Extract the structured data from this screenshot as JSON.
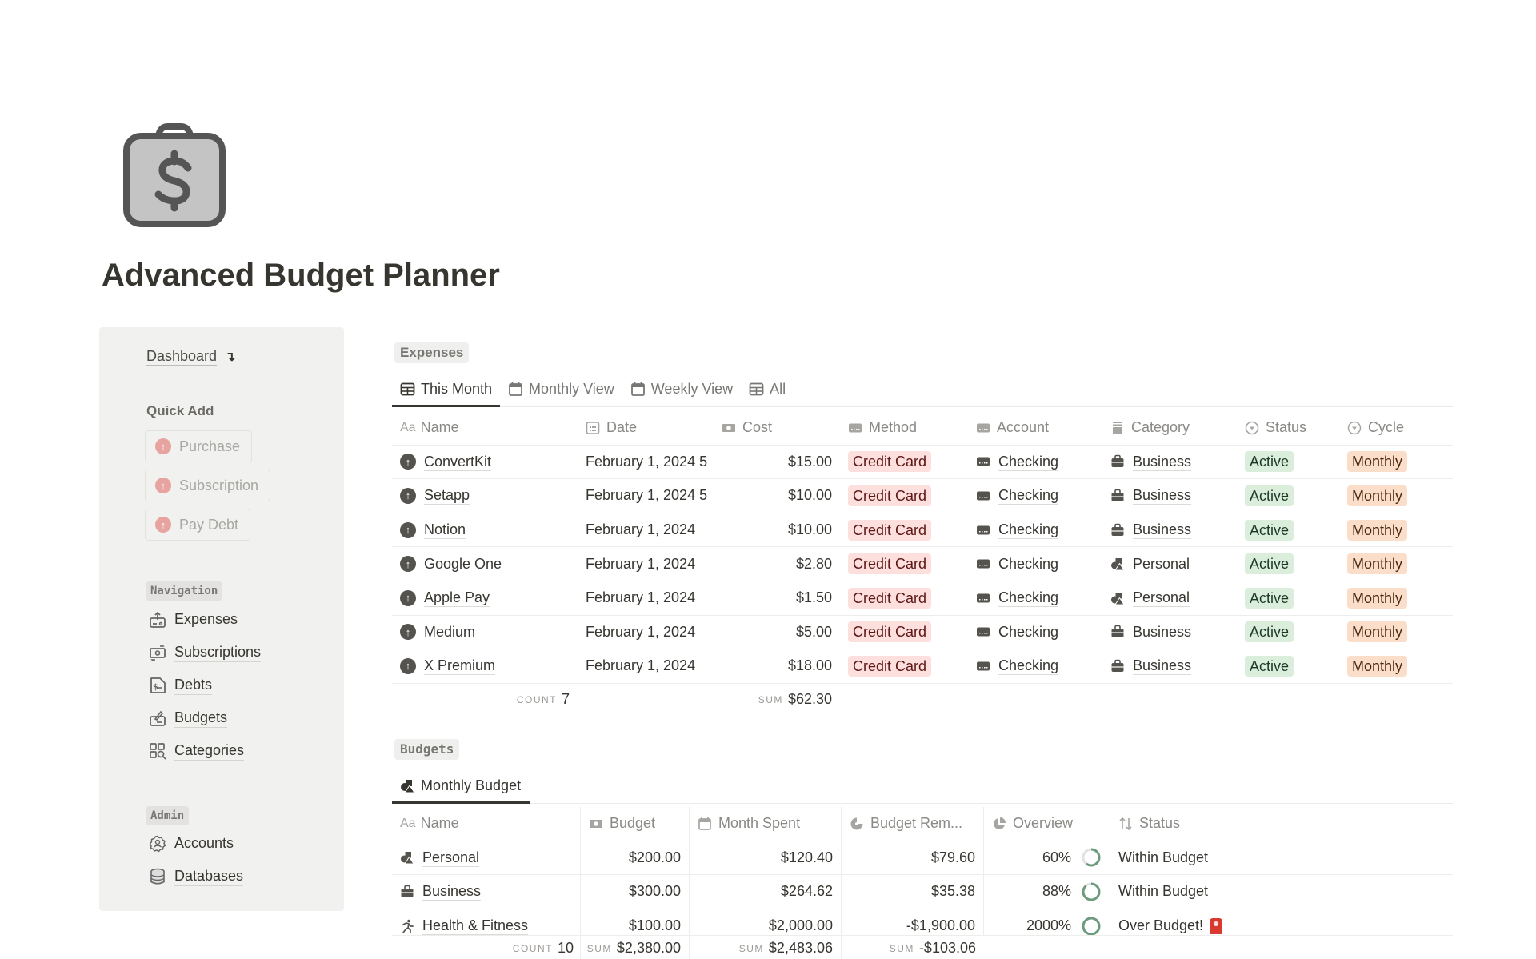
{
  "page": {
    "icon": "shopping-bag-dollar-icon",
    "title": "Advanced Budget Planner"
  },
  "sidebar": {
    "dashboard_label": "Dashboard",
    "dashboard_arrow": "↴",
    "quick_add_title": "Quick Add",
    "quick_add_buttons": [
      {
        "label": "Purchase",
        "icon": "arrow-up-circle-icon"
      },
      {
        "label": "Subscription",
        "icon": "arrow-up-circle-icon"
      },
      {
        "label": "Pay Debt",
        "icon": "arrow-up-circle-icon"
      }
    ],
    "navigation_tag": "Navigation",
    "navigation_items": [
      {
        "label": "Expenses",
        "icon": "money-out-icon"
      },
      {
        "label": "Subscriptions",
        "icon": "money-cycle-icon"
      },
      {
        "label": "Debts",
        "icon": "invoice-dollar-icon"
      },
      {
        "label": "Budgets",
        "icon": "signature-icon"
      },
      {
        "label": "Categories",
        "icon": "grid-search-icon"
      }
    ],
    "admin_tag": "Admin",
    "admin_items": [
      {
        "label": "Accounts",
        "icon": "gear-user-icon"
      },
      {
        "label": "Databases",
        "icon": "database-icon"
      }
    ]
  },
  "expenses": {
    "section_label": "Expenses",
    "tabs": [
      {
        "label": "This Month",
        "icon": "table-icon",
        "active": true
      },
      {
        "label": "Monthly View",
        "icon": "calendar-icon",
        "active": false
      },
      {
        "label": "Weekly View",
        "icon": "calendar-icon",
        "active": false
      },
      {
        "label": "All",
        "icon": "table-icon",
        "active": false
      }
    ],
    "columns": [
      "Name",
      "Date",
      "Cost",
      "Method",
      "Account",
      "Category",
      "Status",
      "Cycle"
    ],
    "rows": [
      {
        "name": "ConvertKit",
        "date": "February 1, 2024 5",
        "cost": "$15.00",
        "method": "Credit Card",
        "account": "Checking",
        "category": "Business",
        "status": "Active",
        "cycle": "Monthly"
      },
      {
        "name": "Setapp",
        "date": "February 1, 2024 5",
        "cost": "$10.00",
        "method": "Credit Card",
        "account": "Checking",
        "category": "Business",
        "status": "Active",
        "cycle": "Monthly"
      },
      {
        "name": "Notion",
        "date": "February 1, 2024",
        "cost": "$10.00",
        "method": "Credit Card",
        "account": "Checking",
        "category": "Business",
        "status": "Active",
        "cycle": "Monthly"
      },
      {
        "name": "Google One",
        "date": "February 1, 2024",
        "cost": "$2.80",
        "method": "Credit Card",
        "account": "Checking",
        "category": "Personal",
        "status": "Active",
        "cycle": "Monthly"
      },
      {
        "name": "Apple Pay",
        "date": "February 1, 2024",
        "cost": "$1.50",
        "method": "Credit Card",
        "account": "Checking",
        "category": "Personal",
        "status": "Active",
        "cycle": "Monthly"
      },
      {
        "name": "Medium",
        "date": "February 1, 2024",
        "cost": "$5.00",
        "method": "Credit Card",
        "account": "Checking",
        "category": "Business",
        "status": "Active",
        "cycle": "Monthly"
      },
      {
        "name": "X Premium",
        "date": "February 1, 2024",
        "cost": "$18.00",
        "method": "Credit Card",
        "account": "Checking",
        "category": "Business",
        "status": "Active",
        "cycle": "Monthly"
      }
    ],
    "footer": {
      "count_label": "COUNT",
      "count_value": "7",
      "sum_label": "SUM",
      "sum_value": "$62.30"
    }
  },
  "budgets": {
    "section_label": "Budgets",
    "tabs": [
      {
        "label": "Monthly Budget",
        "icon": "shapes-icon",
        "active": true
      }
    ],
    "columns": [
      "Name",
      "Budget",
      "Month Spent",
      "Budget Rem...",
      "Overview",
      "Status"
    ],
    "rows": [
      {
        "name": "Personal",
        "icon": "shapes-icon",
        "budget": "$200.00",
        "spent": "$120.40",
        "remaining": "$79.60",
        "overview": "60%",
        "overview_fraction": 0.6,
        "status": "Within Budget"
      },
      {
        "name": "Business",
        "icon": "briefcase-icon",
        "budget": "$300.00",
        "spent": "$264.62",
        "remaining": "$35.38",
        "overview": "88%",
        "overview_fraction": 0.88,
        "status": "Within Budget"
      },
      {
        "name": "Health & Fitness",
        "icon": "running-icon",
        "budget": "$100.00",
        "spent": "$2,000.00",
        "remaining": "-$1,900.00",
        "overview": "2000%",
        "overview_fraction": 1.0,
        "status": "Over Budget!",
        "status_icon": "siren-icon"
      }
    ],
    "footer": {
      "count_label": "COUNT",
      "count_value": "10",
      "budget_sum_label": "SUM",
      "budget_sum": "$2,380.00",
      "spent_sum_label": "SUM",
      "spent_sum": "$2,483.06",
      "remaining_sum_label": "SUM",
      "remaining_sum": "-$103.06"
    }
  },
  "colors": {
    "method_tag_bg": "#fde0de",
    "status_tag_bg": "#dbeddb",
    "cycle_tag_bg": "#fadec9",
    "ring_color": "#6c9b7d",
    "quick_add_icon": "#e6a3a0"
  }
}
